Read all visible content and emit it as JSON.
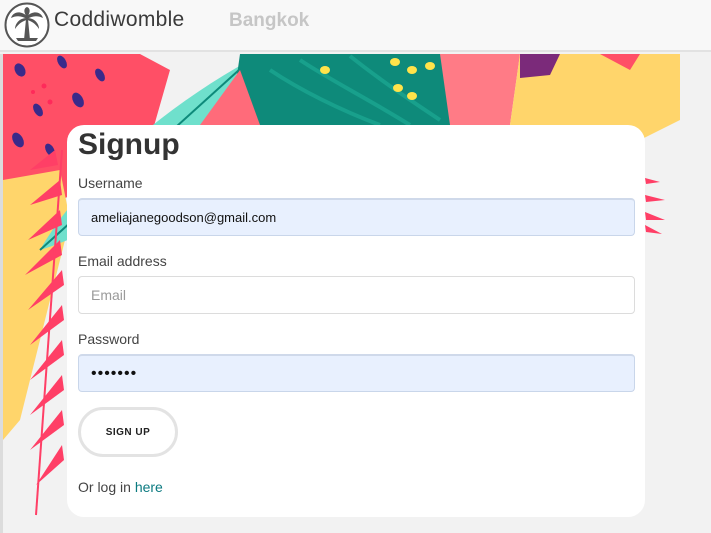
{
  "nav": {
    "brand_name": "Coddiwomble",
    "city": "Bangkok",
    "logo_icon": "palm-tree-logo-icon"
  },
  "form": {
    "title": "Signup",
    "username_label": "Username",
    "username_value": "ameliajanegoodson@gmail.com",
    "email_label": "Email address",
    "email_placeholder": "Email",
    "password_label": "Password",
    "password_value": "•••••••",
    "submit_label": "SIGN UP",
    "login_prefix": "Or log in ",
    "login_link": "here"
  },
  "colors": {
    "accent_link": "#0b7a80",
    "autofill_bg": "#e8f0fe",
    "leaf_red": "#ff4f66",
    "leaf_teal": "#0e8a7a",
    "leaf_mint": "#6fe0cc",
    "leaf_yellow": "#ffd56b",
    "leaf_purple": "#7b2a7a"
  }
}
